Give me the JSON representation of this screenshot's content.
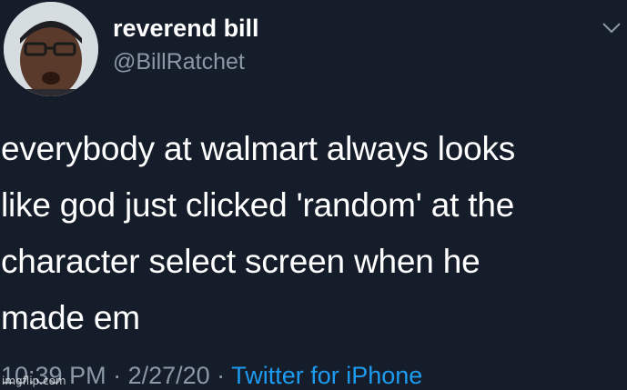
{
  "user": {
    "display_name": "reverend bill",
    "handle": "@BillRatchet"
  },
  "tweet": {
    "lines": [
      "everybody at walmart always looks",
      "like god just clicked 'random' at the",
      "character select screen when he",
      "made em"
    ]
  },
  "meta": {
    "time": "10:39 PM",
    "separator1": " · ",
    "date": "2/27/20",
    "separator2": " · ",
    "source": "Twitter for iPhone"
  },
  "watermark": "imgflip.com",
  "icons": {
    "avatar": "avatar-photo",
    "menu": "chevron-down-icon"
  },
  "colors": {
    "background": "#151c2a",
    "text": "#ffffff",
    "secondary_text": "#8b98a5",
    "link": "#1d9bf0"
  }
}
